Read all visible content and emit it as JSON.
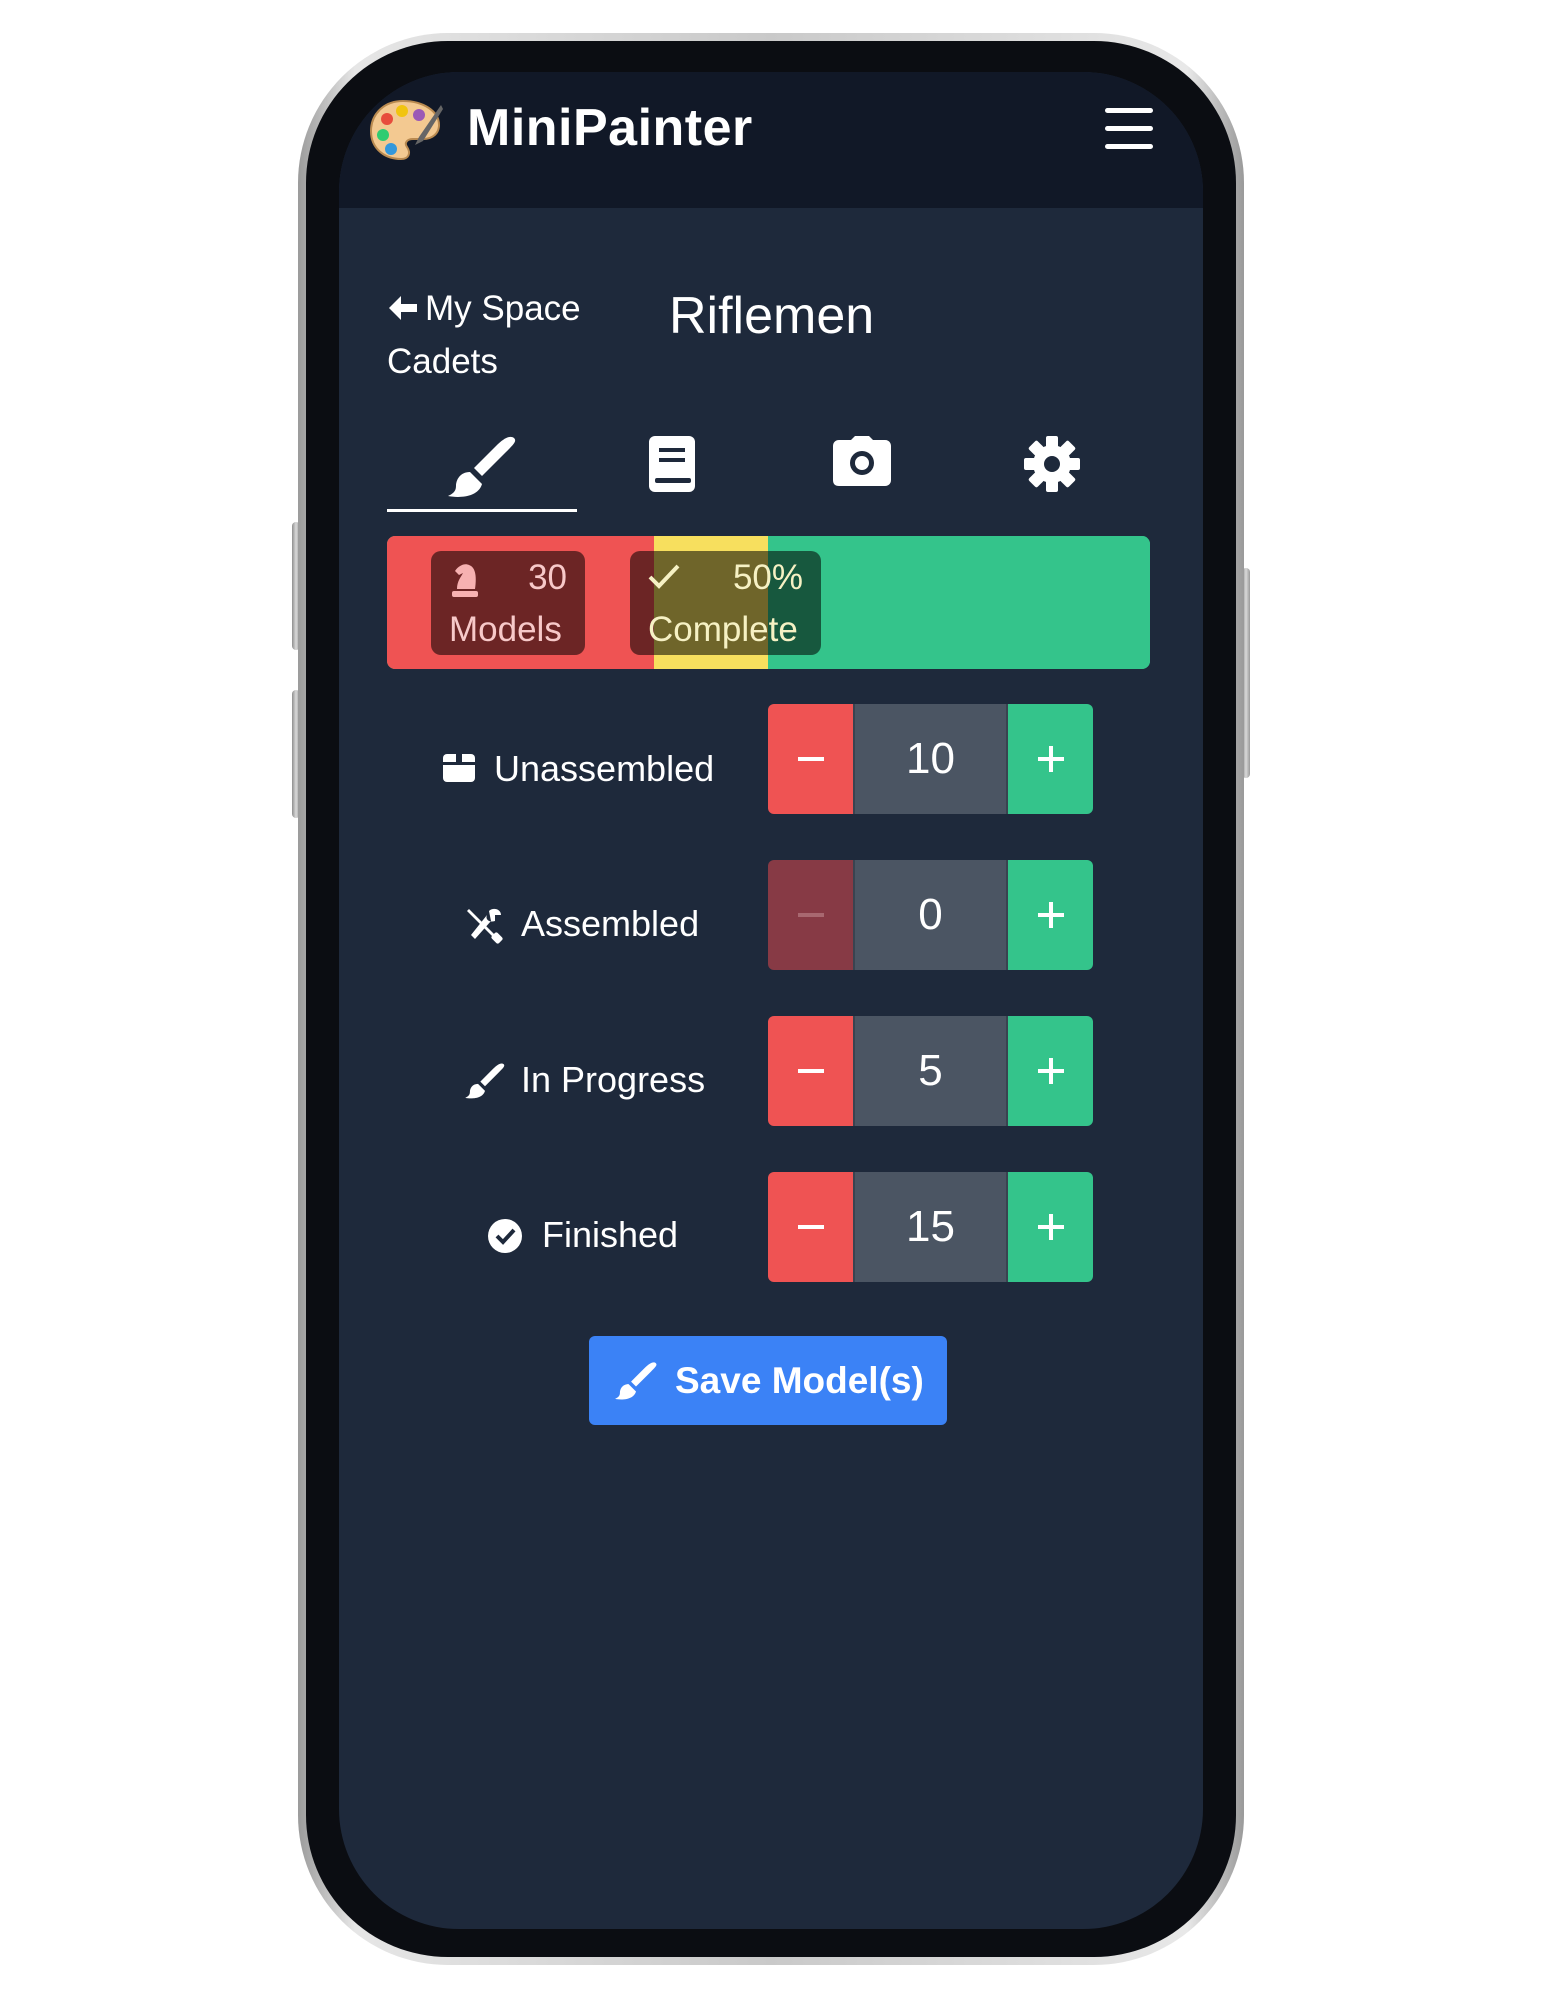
{
  "app": {
    "title": "MiniPainter"
  },
  "header": {
    "back_label": "My Space Cadets",
    "title": "Riflemen"
  },
  "tabs": [
    {
      "icon": "brush-icon",
      "active": true
    },
    {
      "icon": "book-icon",
      "active": false
    },
    {
      "icon": "camera-icon",
      "active": false
    },
    {
      "icon": "gear-icon",
      "active": false
    }
  ],
  "progress": {
    "models_count": "30",
    "models_label": "Models",
    "complete_percent": "50%",
    "complete_label": "Complete",
    "segments": {
      "red": 0.35,
      "yellow": 0.15,
      "green": 0.5
    },
    "colors": {
      "red": "#ef5353",
      "yellow": "#f7df5e",
      "green": "#34c48b"
    }
  },
  "statuses": [
    {
      "label": "Unassembled",
      "icon": "box-icon",
      "value": "10"
    },
    {
      "label": "Assembled",
      "icon": "tools-icon",
      "value": "0"
    },
    {
      "label": "In Progress",
      "icon": "brush-icon",
      "value": "5"
    },
    {
      "label": "Finished",
      "icon": "check-circle-icon",
      "value": "15"
    }
  ],
  "save_button": {
    "label": "Save Model(s)",
    "color": "#3b82f6"
  }
}
